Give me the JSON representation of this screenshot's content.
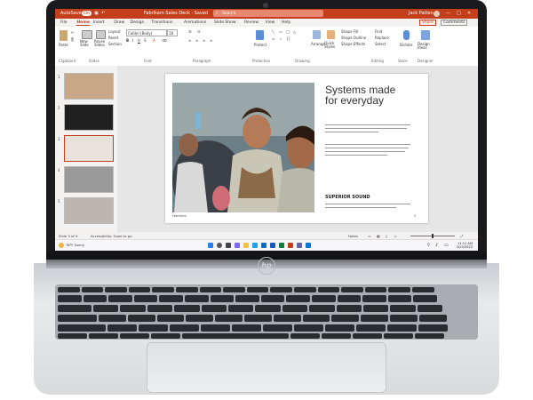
{
  "window": {
    "autosave_label": "AutoSave",
    "autosave_state": "On",
    "doc_title": "Fabrikam Sales Deck · Saved",
    "search_placeholder": "Search",
    "user_name": "Jack Patton"
  },
  "ribbon_tabs": [
    "File",
    "Home",
    "Insert",
    "Draw",
    "Design",
    "Transitions",
    "Animations",
    "Slide Show",
    "Review",
    "View",
    "Help"
  ],
  "active_tab": "Home",
  "actions": {
    "share": "Share",
    "comments": "Comments"
  },
  "ribbon": {
    "paste": "Paste",
    "new_slide": "New Slide",
    "reuse_slides": "Reuse Slides",
    "layout": "Layout",
    "reset": "Reset",
    "section": "Section",
    "font_name": "Calibri (Body)",
    "font_size": "18",
    "protection": "Protect",
    "arrange": "Arrange",
    "quick_styles": "Quick Styles",
    "shape_fill": "Shape Fill",
    "shape_outline": "Shape Outline",
    "shape_effects": "Shape Effects",
    "find": "Find",
    "replace": "Replace",
    "select": "Select",
    "dictate": "Dictate",
    "designer": "Design Ideas",
    "group_labels": [
      "Clipboard",
      "Slides",
      "Font",
      "Paragraph",
      "Protection",
      "Drawing",
      "Editing",
      "Voice",
      "Designer"
    ]
  },
  "thumbnails": [
    {
      "num": "1",
      "color": "#c8a786"
    },
    {
      "num": "2",
      "color": "#202020"
    },
    {
      "num": "3",
      "color": "#e8e2dc"
    },
    {
      "num": "4",
      "color": "#9a9a9a"
    },
    {
      "num": "5",
      "color": "#bdb6b0"
    }
  ],
  "slide": {
    "title_line1": "Systems made",
    "title_line2": "for everyday",
    "subheading": "SUPERIOR SOUND",
    "footer_left": "Fabrikam",
    "footer_right": "3"
  },
  "statusbar": {
    "slide_info": "Slide 3 of 9",
    "accessibility": "Accessibility: Good to go",
    "notes": "Notes",
    "zoom": "—"
  },
  "taskbar": {
    "weather": "78°F Sunny",
    "time": "11:11 AM",
    "date": "3/29/2023"
  },
  "brand": {
    "logo": "hp",
    "accent": "#c43e1c"
  }
}
